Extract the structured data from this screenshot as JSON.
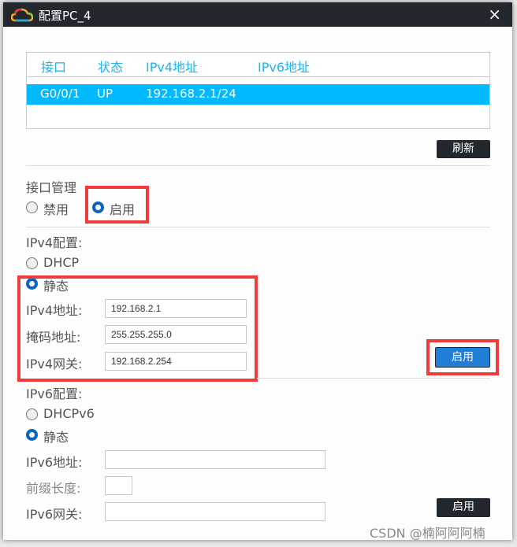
{
  "window": {
    "title": "配置PC_4",
    "close": "×"
  },
  "table": {
    "headers": [
      "接口",
      "状态",
      "IPv4地址",
      "IPv6地址"
    ],
    "rows": [
      {
        "interface": "G0/0/1",
        "status": "UP",
        "ipv4": "192.168.2.1/24",
        "ipv6": ""
      }
    ]
  },
  "refresh_label": "刷新",
  "interface_mgmt": {
    "label": "接口管理",
    "disable": "禁用",
    "enable": "启用",
    "selected": "启用"
  },
  "ipv4": {
    "label": "IPv4配置:",
    "dhcp": "DHCP",
    "static": "静态",
    "selected": "静态",
    "addr_label": "IPv4地址:",
    "addr": "192.168.2.1",
    "mask_label": "掩码地址:",
    "mask": "255.255.255.0",
    "gw_label": "IPv4网关:",
    "gw": "192.168.2.254",
    "apply": "启用"
  },
  "ipv6": {
    "label": "IPv6配置:",
    "dhcp": "DHCPv6",
    "static": "静态",
    "selected": "静态",
    "addr_label": "IPv6地址:",
    "addr": "",
    "prefix_label": "前缀长度:",
    "prefix": "",
    "gw_label": "IPv6网关:",
    "gw": "",
    "apply": "启用"
  },
  "watermark": "CSDN @楠阿阿阿楠",
  "colors": {
    "titlebar": "#23272e",
    "selected_row": "#00b9ff",
    "header_text": "#1eb3f2",
    "highlight": "#f23b3b",
    "radio": "#0b63c0"
  }
}
